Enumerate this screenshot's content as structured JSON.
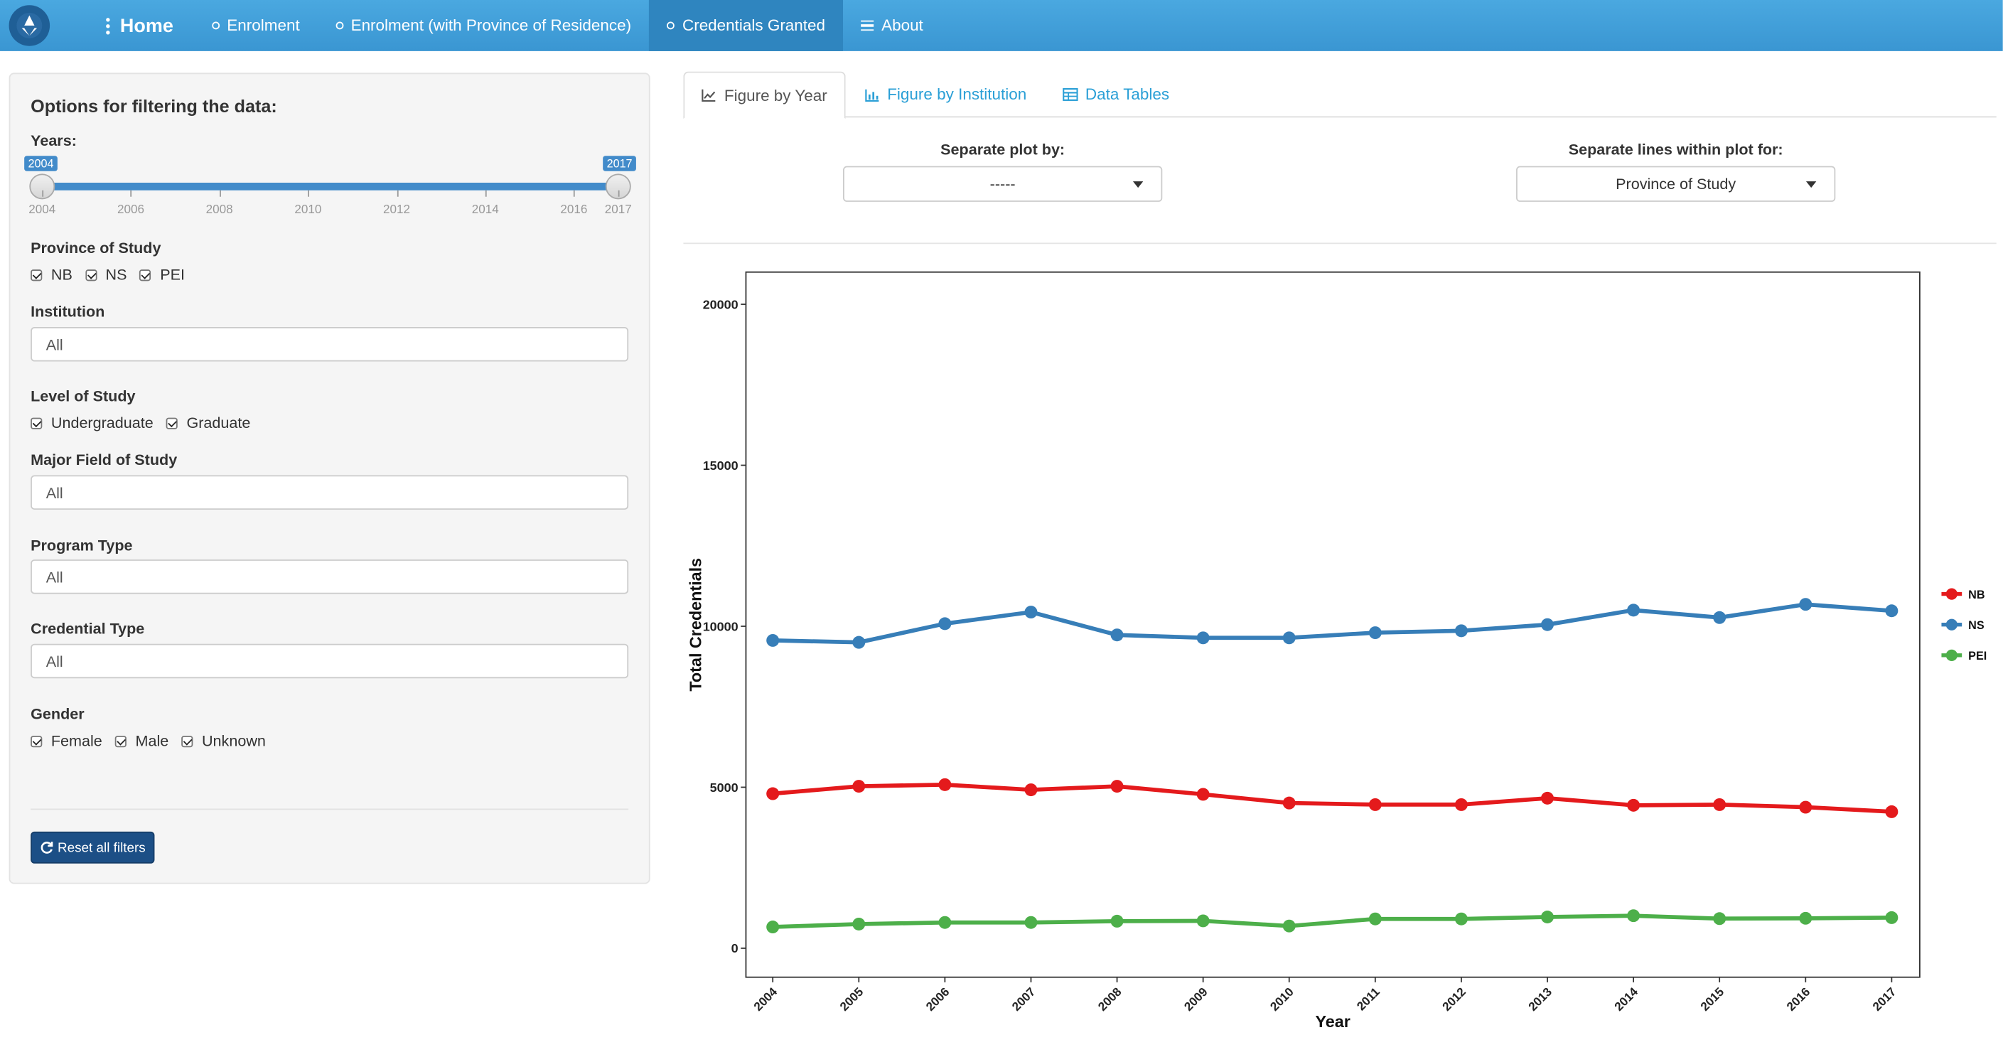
{
  "nav": {
    "home": "Home",
    "items": [
      "Enrolment",
      "Enrolment (with Province of Residence)",
      "Credentials Granted",
      "About"
    ]
  },
  "sidebar": {
    "title": "Options for filtering the data:",
    "years_label": "Years:",
    "years_min": "2004",
    "years_max": "2017",
    "year_ticks": [
      "2004",
      "2006",
      "2008",
      "2010",
      "2012",
      "2014",
      "2016",
      "2017"
    ],
    "province_label": "Province of Study",
    "provinces": [
      "NB",
      "NS",
      "PEI"
    ],
    "institution_label": "Institution",
    "institution_value": "All",
    "level_label": "Level of Study",
    "levels": [
      "Undergraduate",
      "Graduate"
    ],
    "field_label": "Major Field of Study",
    "field_value": "All",
    "program_label": "Program Type",
    "program_value": "All",
    "credential_label": "Credential Type",
    "credential_value": "All",
    "gender_label": "Gender",
    "genders": [
      "Female",
      "Male",
      "Unknown"
    ],
    "reset_label": "Reset all filters"
  },
  "tabs": [
    "Figure by Year",
    "Figure by Institution",
    "Data Tables"
  ],
  "controls": {
    "separate_plot_label": "Separate plot by:",
    "separate_plot_value": "-----",
    "separate_lines_label": "Separate lines within plot for:",
    "separate_lines_value": "Province of Study"
  },
  "chart_data": {
    "type": "line",
    "xlabel": "Year",
    "ylabel": "Total Credentials",
    "ylim": [
      -900,
      21000
    ],
    "yticks": [
      0,
      5000,
      10000,
      15000,
      20000
    ],
    "x": [
      "2004",
      "2005",
      "2006",
      "2007",
      "2008",
      "2009",
      "2010",
      "2011",
      "2012",
      "2013",
      "2014",
      "2015",
      "2016",
      "2017"
    ],
    "legend_position": "right",
    "series": [
      {
        "name": "NB",
        "color": "#e41a1c",
        "values": [
          4800,
          5030,
          5080,
          4920,
          5030,
          4780,
          4510,
          4460,
          4460,
          4660,
          4440,
          4460,
          4380,
          4240
        ]
      },
      {
        "name": "NS",
        "color": "#377eb8",
        "values": [
          9560,
          9500,
          10080,
          10440,
          9730,
          9640,
          9640,
          9800,
          9860,
          10050,
          10500,
          10270,
          10680,
          10480
        ]
      },
      {
        "name": "PEI",
        "color": "#4daf4a",
        "values": [
          660,
          750,
          800,
          800,
          840,
          850,
          690,
          910,
          910,
          970,
          1010,
          920,
          930,
          950
        ]
      }
    ]
  }
}
